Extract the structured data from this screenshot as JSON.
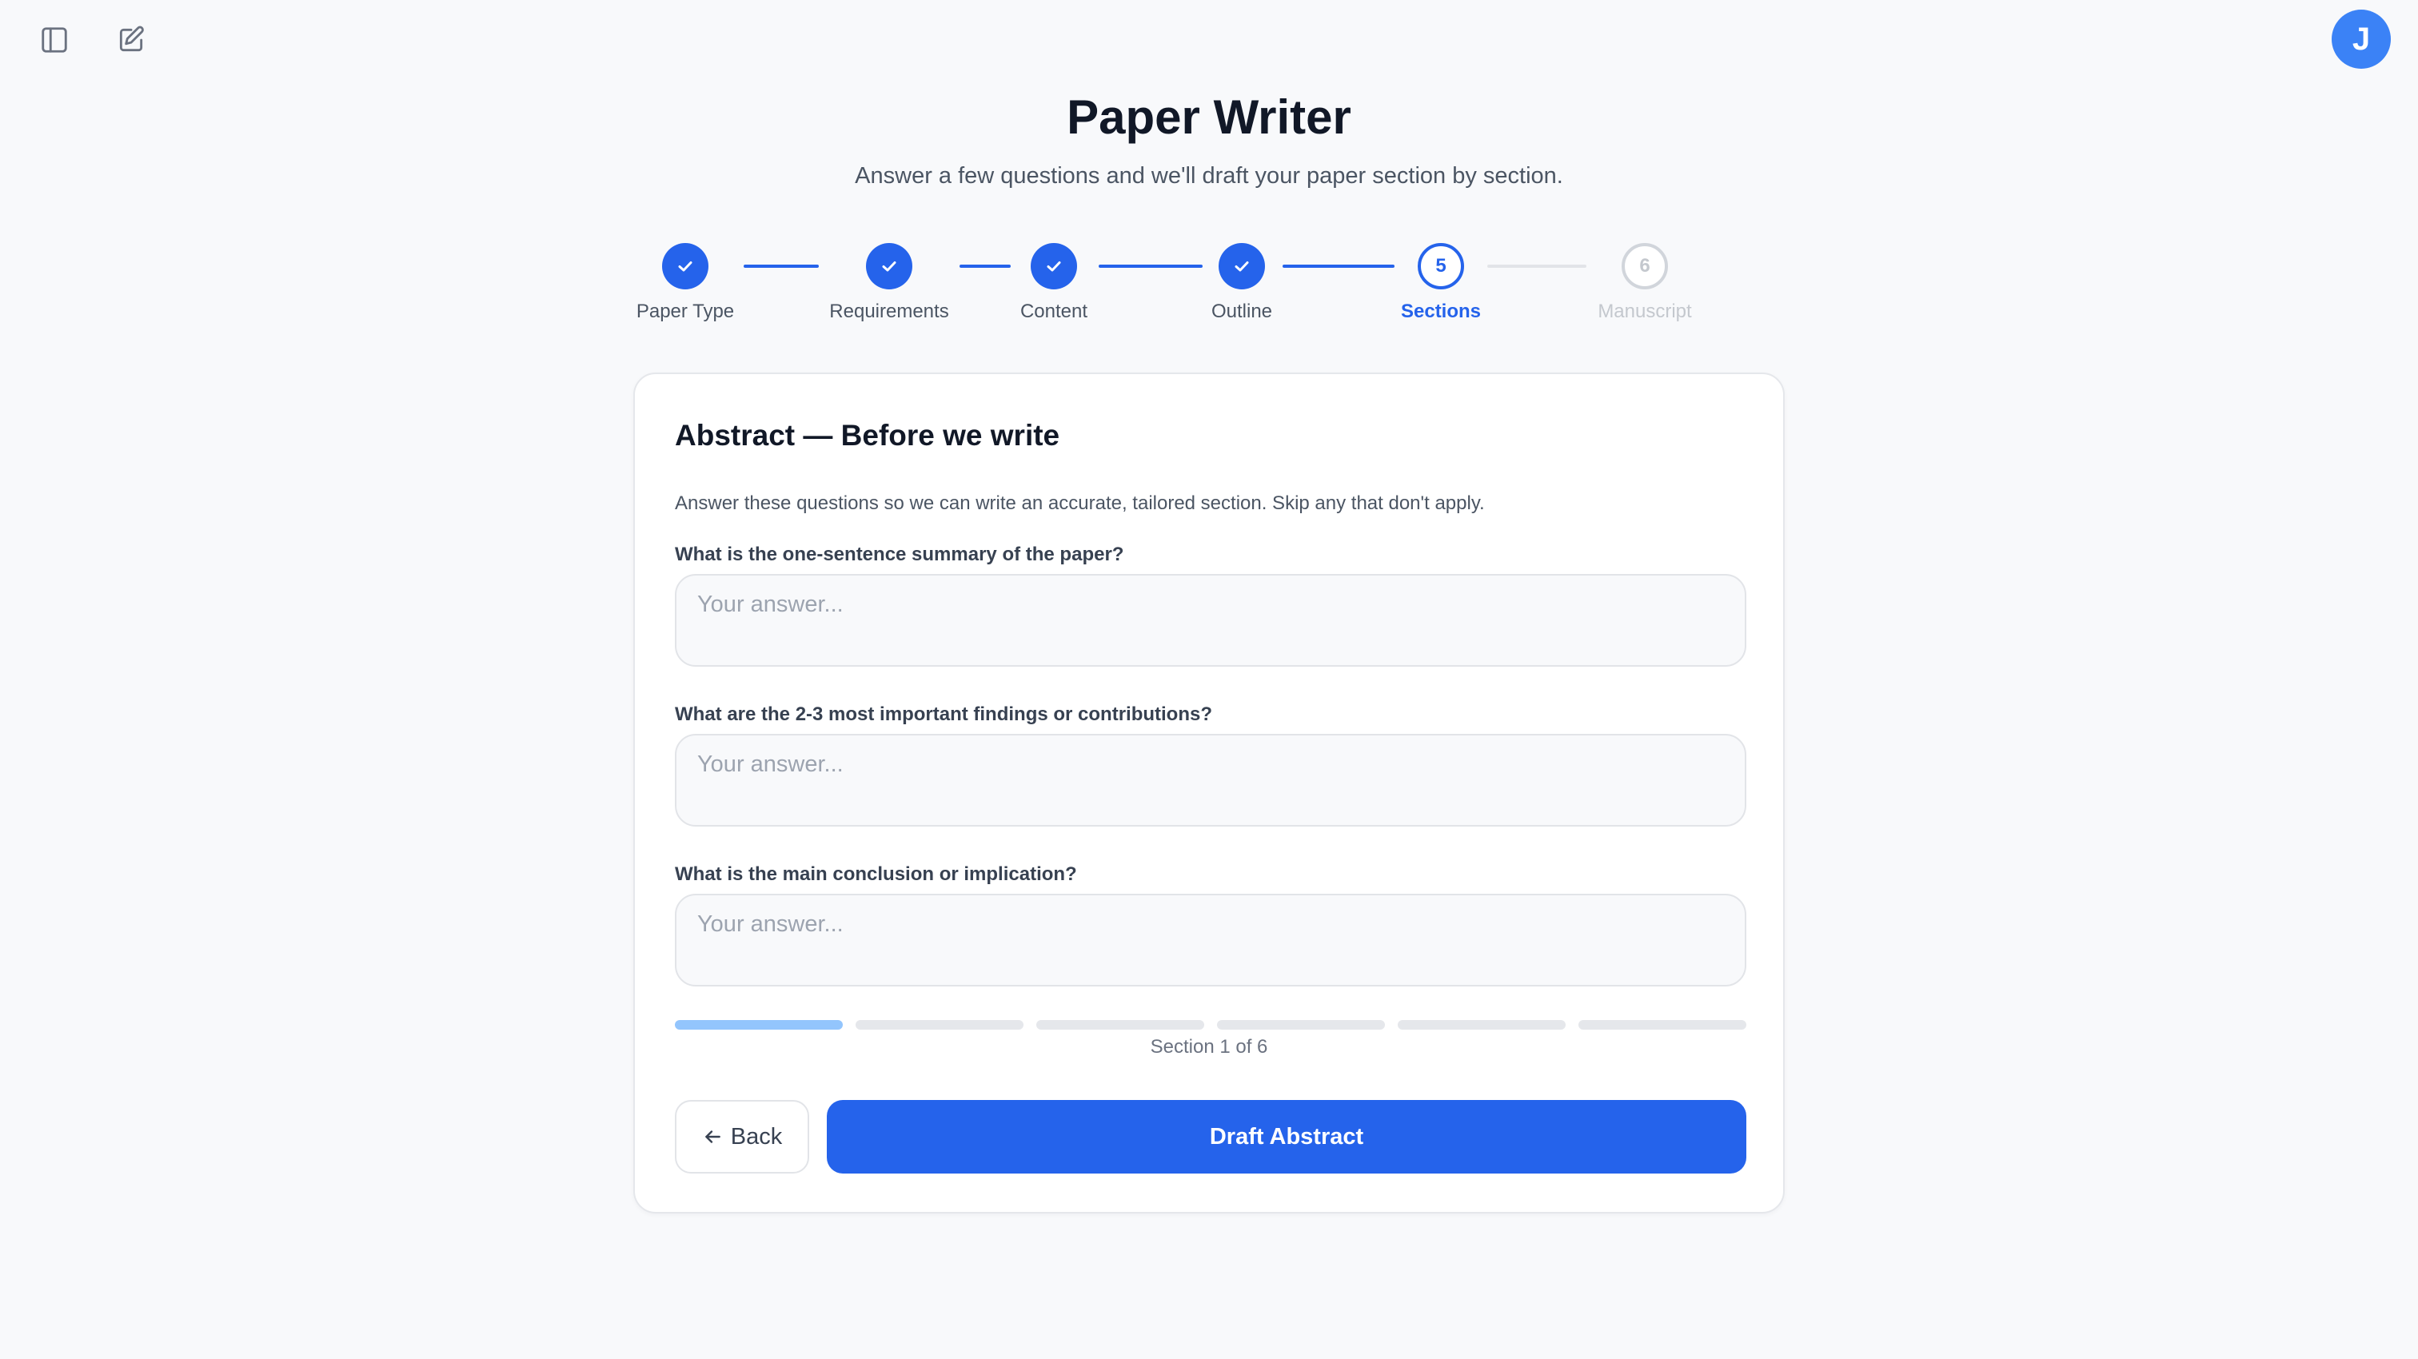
{
  "app": {
    "title": "Paper Writer",
    "subtitle": "Answer a few questions and we'll draft your paper section by section.",
    "avatar_initial": "J"
  },
  "icons": {
    "sidebar_toggle": "sidebar-icon",
    "new_chat": "edit-icon",
    "check": "check-icon",
    "back_arrow": "arrow-left-icon"
  },
  "stepper": {
    "steps": [
      {
        "label": "Paper Type",
        "number": "1",
        "state": "done"
      },
      {
        "label": "Requirements",
        "number": "2",
        "state": "done"
      },
      {
        "label": "Content",
        "number": "3",
        "state": "done"
      },
      {
        "label": "Outline",
        "number": "4",
        "state": "done"
      },
      {
        "label": "Sections",
        "number": "5",
        "state": "current"
      },
      {
        "label": "Manuscript",
        "number": "6",
        "state": "pending"
      }
    ]
  },
  "card": {
    "title": "Abstract — Before we write",
    "description": "Answer these questions so we can write an accurate, tailored section. Skip any that don't apply.",
    "questions": [
      {
        "label": "What is the one-sentence summary of the paper?",
        "value": "",
        "placeholder": "Your answer..."
      },
      {
        "label": "What are the 2-3 most important findings or contributions?",
        "value": "",
        "placeholder": "Your answer..."
      },
      {
        "label": "What is the main conclusion or implication?",
        "value": "",
        "placeholder": "Your answer..."
      }
    ],
    "progress": {
      "current": 1,
      "total": 6,
      "text": "Section 1 of 6"
    },
    "back_label": "Back",
    "draft_label": "Draft Abstract"
  },
  "colors": {
    "accent": "#2563eb",
    "progress_fill": "#93c5fd",
    "background": "#f8f9fb",
    "avatar": "#3b82f6"
  }
}
